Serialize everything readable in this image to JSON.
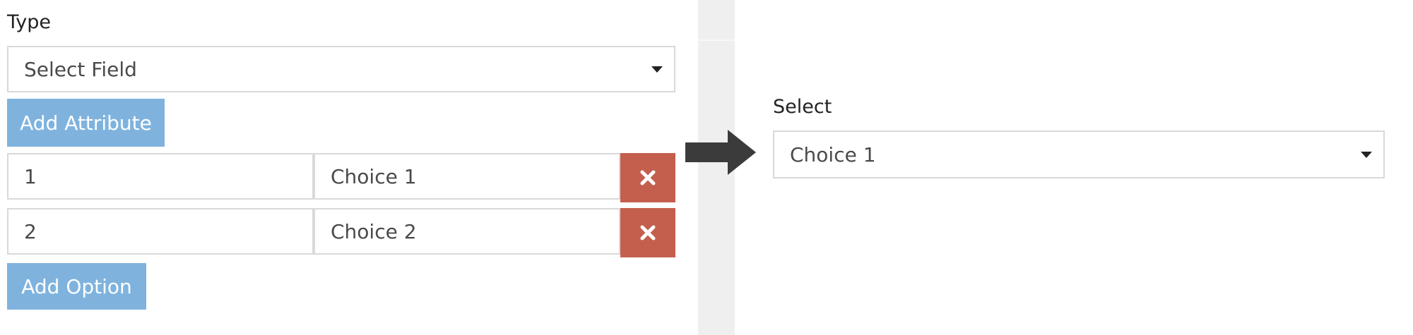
{
  "builder": {
    "type_label": "Type",
    "type_select": {
      "value": "Select Field"
    },
    "add_attribute_label": "Add Attribute",
    "options": [
      {
        "value": "1",
        "label": "Choice 1"
      },
      {
        "value": "2",
        "label": "Choice 2"
      }
    ],
    "add_option_label": "Add Option"
  },
  "preview": {
    "label": "Select",
    "select_value": "Choice 1"
  },
  "icons": {
    "remove": "close-icon",
    "arrow": "arrow-right-icon",
    "dropdown": "chevron-down-icon"
  },
  "colors": {
    "primary_button": "#7fb3de",
    "danger_button": "#c45f4e",
    "arrow": "#3b3b3b",
    "divider": "#efefef"
  }
}
